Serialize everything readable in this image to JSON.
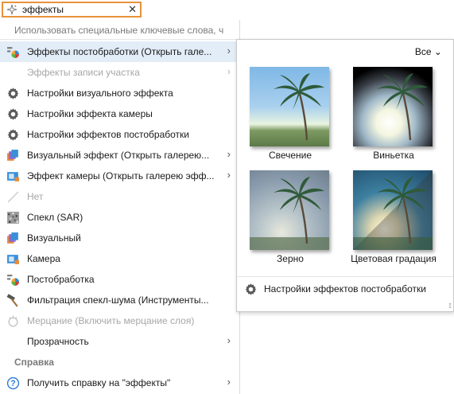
{
  "search": {
    "value": "эффекты",
    "icon": "sparkle-icon",
    "clear_glyph": "✕"
  },
  "menu": {
    "hint": "Использовать специальные ключевые слова, ч",
    "items": [
      {
        "label": "Эффекты постобработки (Открыть гале...",
        "icon": "postprocess-effects-icon",
        "arrow": "›"
      },
      {
        "label": "Эффекты записи участка",
        "icon": "none",
        "arrow": "›"
      },
      {
        "label": "Настройки визуального эффекта",
        "icon": "gear-icon"
      },
      {
        "label": "Настройки эффекта камеры",
        "icon": "gear-icon"
      },
      {
        "label": "Настройки эффектов постобработки",
        "icon": "gear-icon"
      },
      {
        "label": "Визуальный эффект (Открыть галерею...",
        "icon": "visual-effect-icon",
        "arrow": "›"
      },
      {
        "label": "Эффект камеры (Открыть галерею эфф...",
        "icon": "camera-effect-icon",
        "arrow": "›"
      },
      {
        "label": "Нет",
        "icon": "none-slash-icon"
      },
      {
        "label": "Спекл (SAR)",
        "icon": "speckle-icon"
      },
      {
        "label": "Визуальный",
        "icon": "visual-effect-icon"
      },
      {
        "label": "Камера",
        "icon": "camera-effect-icon"
      },
      {
        "label": "Постобработка",
        "icon": "postprocess-effects-icon"
      },
      {
        "label": "Фильтрация спекл-шума (Инструменты...",
        "icon": "hammer-icon"
      },
      {
        "label": "Мерцание (Включить мерцание слоя)",
        "icon": "flicker-icon"
      },
      {
        "label": "Прозрачность",
        "icon": "none",
        "arrow": "›"
      }
    ],
    "help_heading": "Справка",
    "help_item": {
      "label": "Получить справку на \"эффекты\"",
      "icon": "help-icon",
      "arrow": "›"
    }
  },
  "gallery": {
    "filter": "Все ⌄",
    "tiles": [
      {
        "caption": "Свечение",
        "effect": "glow"
      },
      {
        "caption": "Виньетка",
        "effect": "vignette"
      },
      {
        "caption": "Зерно",
        "effect": "grain"
      },
      {
        "caption": "Цветовая градация",
        "effect": "color-grading"
      }
    ],
    "settings_label": "Настройки эффектов постобработки",
    "resize_glyph": "⁞⁞"
  }
}
